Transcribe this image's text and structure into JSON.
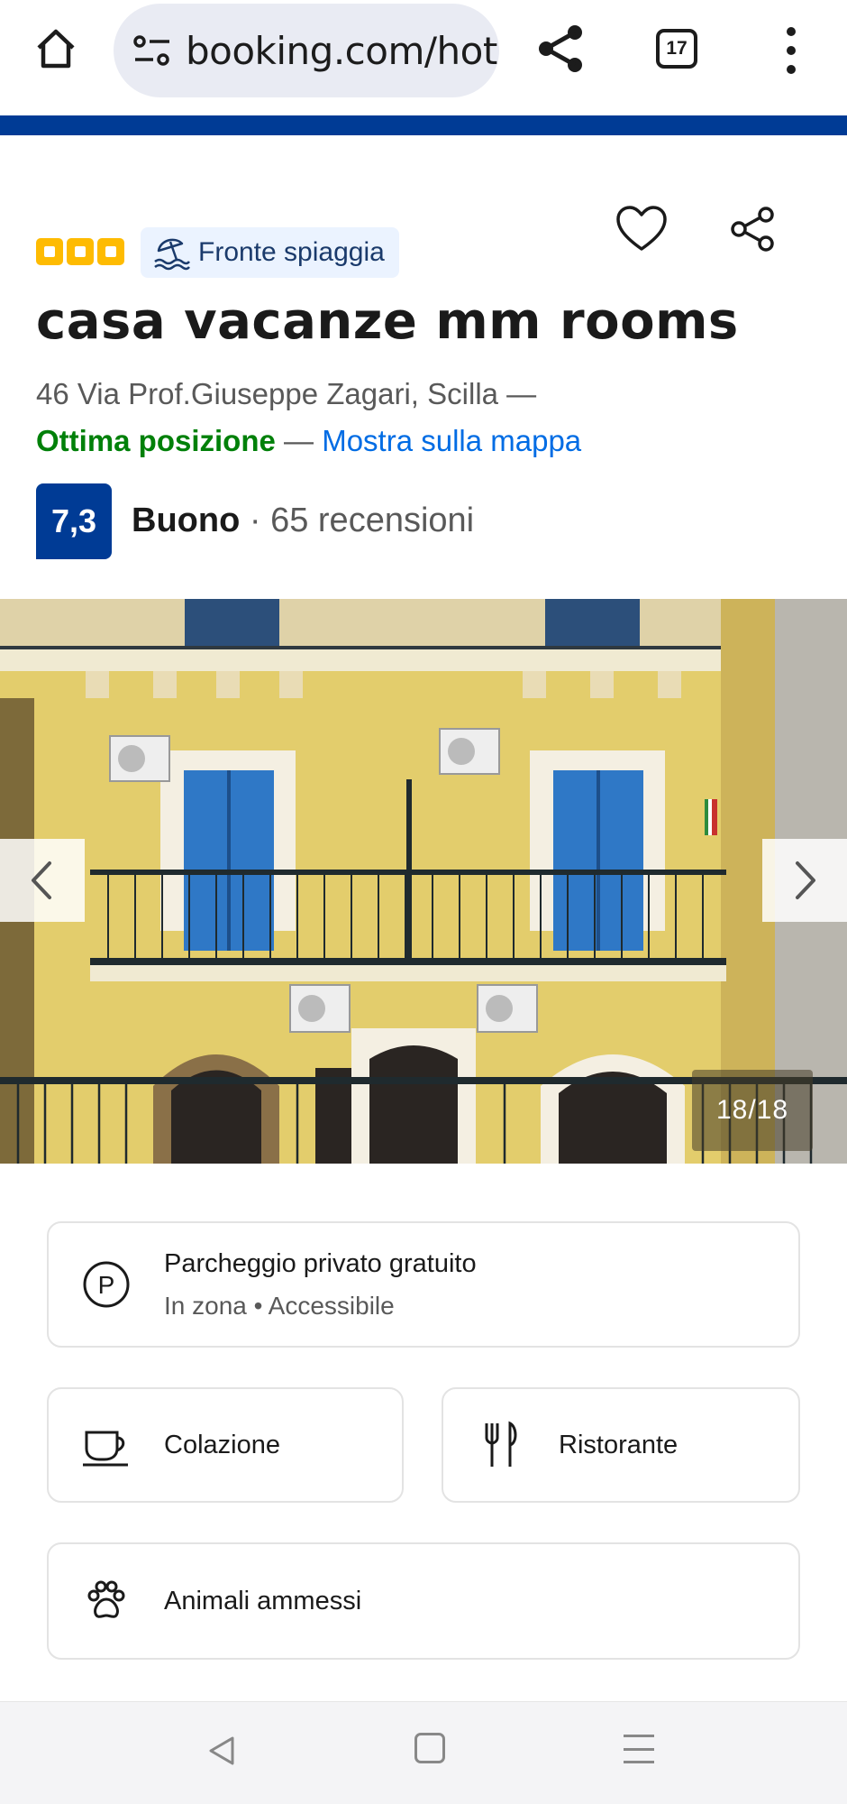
{
  "browser": {
    "url": "booking.com/hot",
    "tab_count": "17",
    "icons": [
      "home-icon",
      "site-settings-icon",
      "share-icon",
      "tabs-icon",
      "more-vert-icon"
    ]
  },
  "accent_colors": {
    "brand_blue": "#003b95",
    "link_blue": "#006ce4",
    "good_green": "#008009",
    "star_yellow": "#febb02"
  },
  "property": {
    "star_rating": 3,
    "badge_label": "Fronte spiaggia",
    "name": "casa vacanze mm rooms",
    "address": "46 Via Prof.Giuseppe Zagari, Scilla —",
    "location_highlight": "Ottima posizione",
    "location_separator": "—",
    "map_link": "Mostra sulla mappa",
    "score": "7,3",
    "score_word": "Buono",
    "score_separator": "·",
    "reviews": "65 recensioni"
  },
  "gallery": {
    "counter": "18/18",
    "current": 18,
    "total": 18
  },
  "facilities": {
    "parking_title": "Parcheggio privato gratuito",
    "parking_sub": "In zona • Accessibile",
    "breakfast": "Colazione",
    "restaurant": "Ristorante",
    "pets": "Animali ammessi"
  }
}
